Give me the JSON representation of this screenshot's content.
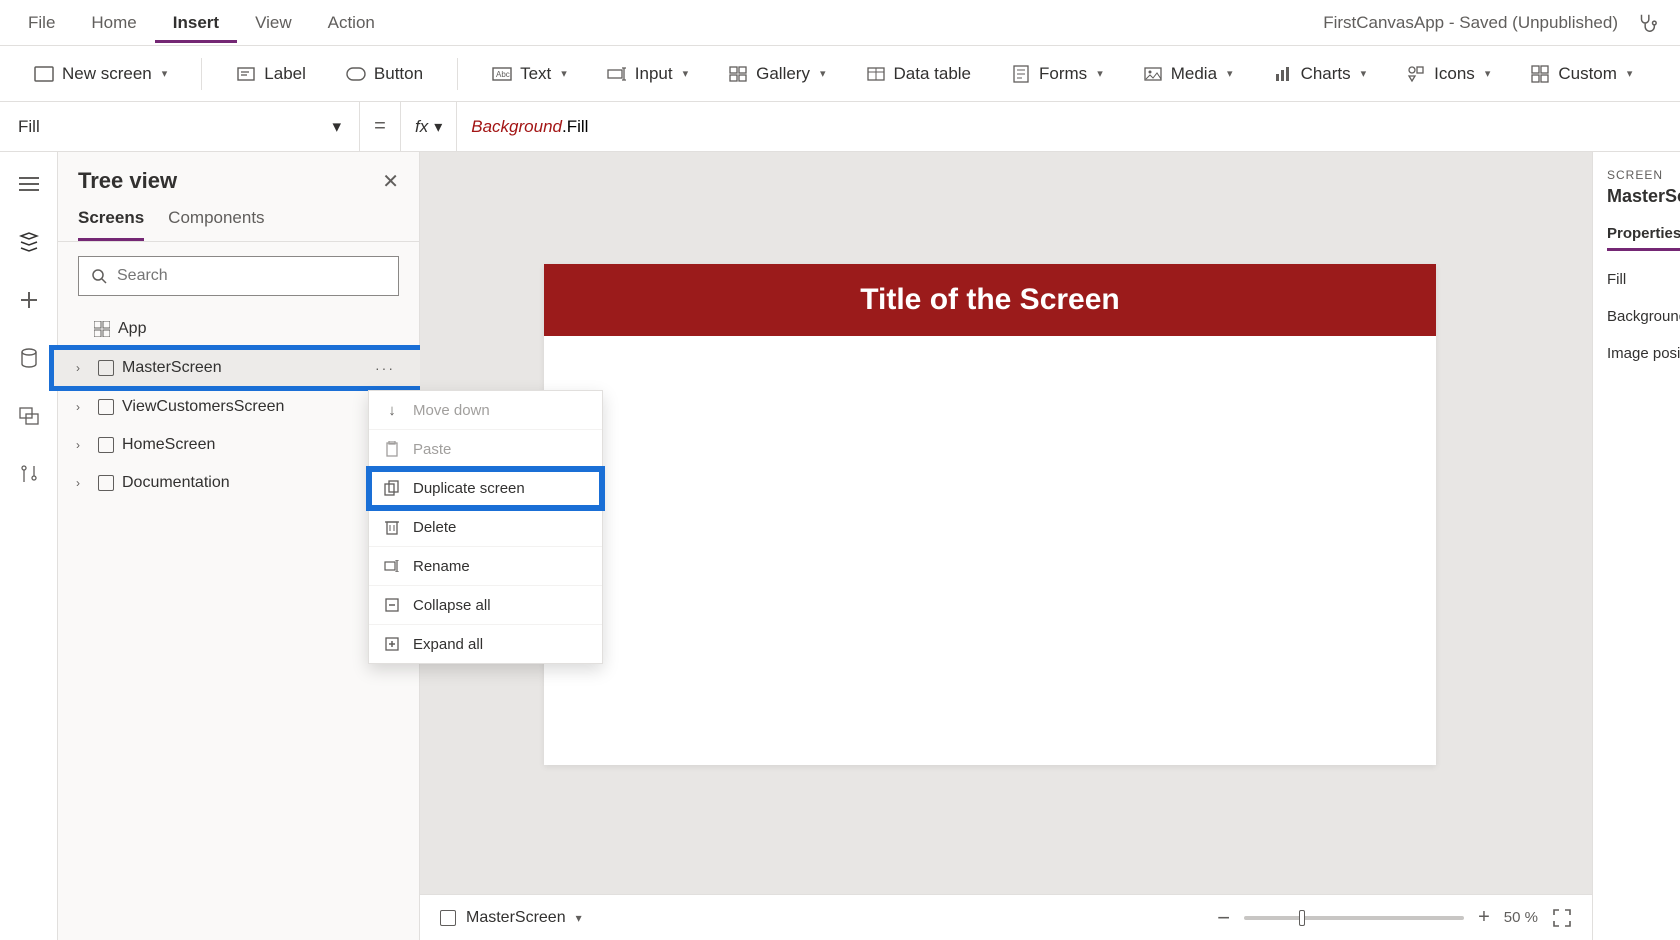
{
  "menu": {
    "items": [
      "File",
      "Home",
      "Insert",
      "View",
      "Action"
    ],
    "active_index": 2,
    "app_title": "FirstCanvasApp - Saved (Unpublished)"
  },
  "ribbon": {
    "new_screen": "New screen",
    "label": "Label",
    "button": "Button",
    "text": "Text",
    "input": "Input",
    "gallery": "Gallery",
    "data_table": "Data table",
    "forms": "Forms",
    "media": "Media",
    "charts": "Charts",
    "icons": "Icons",
    "custom": "Custom"
  },
  "formula": {
    "property": "Fill",
    "fx": "fx",
    "object": "Background",
    "dot_prop": ".Fill"
  },
  "tree": {
    "title": "Tree view",
    "tabs": {
      "screens": "Screens",
      "components": "Components"
    },
    "search_placeholder": "Search",
    "items": [
      {
        "label": "App",
        "type": "app"
      },
      {
        "label": "MasterScreen",
        "type": "screen",
        "selected": true
      },
      {
        "label": "ViewCustomersScreen",
        "type": "screen"
      },
      {
        "label": "HomeScreen",
        "type": "screen"
      },
      {
        "label": "Documentation",
        "type": "screen"
      }
    ],
    "more": "···"
  },
  "context_menu": {
    "items": [
      {
        "label": "Move down",
        "icon": "arrow-down",
        "disabled": true
      },
      {
        "label": "Paste",
        "icon": "paste",
        "disabled": true
      },
      {
        "label": "Duplicate screen",
        "icon": "duplicate",
        "highlighted": true
      },
      {
        "label": "Delete",
        "icon": "delete"
      },
      {
        "label": "Rename",
        "icon": "rename"
      },
      {
        "label": "Collapse all",
        "icon": "collapse"
      },
      {
        "label": "Expand all",
        "icon": "expand"
      }
    ]
  },
  "canvas": {
    "title_text": "Title of the Screen"
  },
  "status": {
    "screen_name": "MasterScreen",
    "zoom_pct": "50",
    "zoom_unit": "%"
  },
  "props": {
    "label": "SCREEN",
    "name": "MasterScre",
    "tab": "Properties",
    "rows": [
      "Fill",
      "Background",
      "Image posit"
    ]
  }
}
